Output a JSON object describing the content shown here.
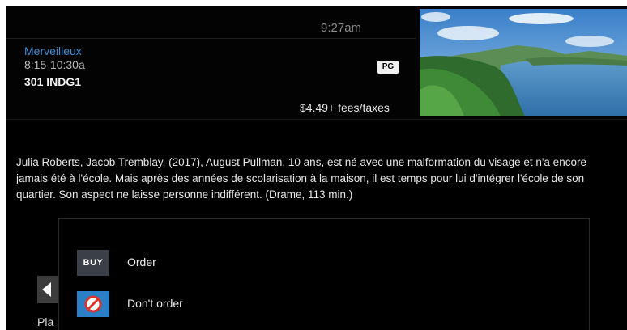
{
  "header": {
    "clock": "9:27am",
    "channel_title": "Merveilleux",
    "time_range": "8:15-10:30a",
    "channel_name": "301 INDG1",
    "rating": "PG",
    "price": "$4.49+ fees/taxes"
  },
  "thumbnail": {
    "icon": "landscape-image"
  },
  "description": "Julia Roberts, Jacob Tremblay, (2017), August Pullman, 10 ans, est né avec une malformation du visage et n'a encore jamais été à l'école. Mais après des années de scolarisation à la maison, il est temps pour lui d'intégrer l'école de son quartier. Son aspect ne laisse personne indifférent. (Drame, 113 min.)",
  "back": {
    "icon": "back-arrow-icon",
    "label": "Pla"
  },
  "dialog": {
    "options": [
      {
        "icon_text": "BUY",
        "label": "Order"
      },
      {
        "icon": "prohibited-icon",
        "label": "Don't order"
      }
    ]
  },
  "colors": {
    "accent": "#3a8fd6",
    "dont_order_icon": "#2a7fc7",
    "buy_icon": "#3b3f48"
  }
}
